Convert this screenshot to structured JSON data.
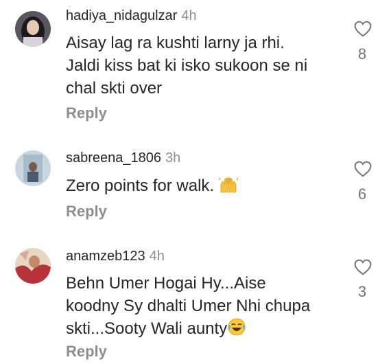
{
  "comments": [
    {
      "username": "hadiya_nidagulzar",
      "time": "4h",
      "text": "Aisay lag ra kushti larny ja rhi. Jaldi kiss bat ki isko sukoon se ni chal skti over",
      "reply_label": "Reply",
      "like_count": "8",
      "like_icon": "heart-outline-icon"
    },
    {
      "username": "sabreena_1806",
      "time": "3h",
      "text": "Zero points for walk.",
      "emoji_icon": "raising-hands-emoji-icon",
      "reply_label": "Reply",
      "like_count": "6",
      "like_icon": "heart-outline-icon"
    },
    {
      "username": "anamzeb123",
      "time": "4h",
      "text": "Behn Umer Hogai Hy...Aise koodny Sy dhalti Umer Nhi chupa skti...Sooty Wali aunty",
      "emoji_icon": "face-with-tears-of-joy-emoji-icon",
      "reply_label": "Reply",
      "like_count": "3",
      "like_icon": "heart-outline-icon"
    }
  ]
}
